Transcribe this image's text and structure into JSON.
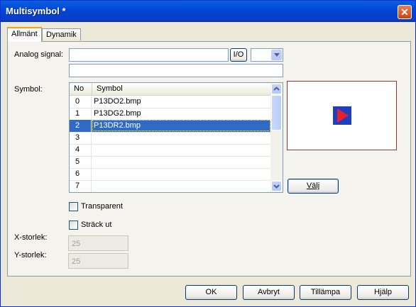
{
  "window": {
    "title": "Multisymbol *",
    "close_glyph": "✕"
  },
  "tabs": [
    {
      "label": "Allmänt"
    },
    {
      "label": "Dynamik"
    }
  ],
  "form": {
    "analog_signal_label": "Analog signal:",
    "analog_signal_value": "",
    "io_button_label": "I/O",
    "combo_value": "",
    "second_field_value": "",
    "symbol_label": "Symbol:",
    "list": {
      "columns": [
        "No",
        "Symbol"
      ],
      "rows": [
        {
          "no": "0",
          "symbol": "P13DO2.bmp"
        },
        {
          "no": "1",
          "symbol": "P13DG2.bmp"
        },
        {
          "no": "2",
          "symbol": "P13DR2.bmp"
        },
        {
          "no": "3",
          "symbol": ""
        },
        {
          "no": "4",
          "symbol": ""
        },
        {
          "no": "5",
          "symbol": ""
        },
        {
          "no": "6",
          "symbol": ""
        },
        {
          "no": "7",
          "symbol": ""
        }
      ],
      "selected_index": 2
    },
    "choose_button_label": "Välj",
    "transparent_label": "Transparent",
    "transparent_checked": false,
    "stretch_label": "Sträck ut",
    "stretch_checked": false,
    "x_size_label": "X-storlek:",
    "x_size_value": "25",
    "y_size_label": "Y-storlek:",
    "y_size_value": "25"
  },
  "footer": {
    "ok": "OK",
    "cancel": "Avbryt",
    "apply": "Tillämpa",
    "help": "Hjälp"
  },
  "colors": {
    "title_bar": "#0054e3",
    "selection": "#316ac5",
    "preview_symbol_bg": "#1e3fc0",
    "preview_symbol_fg": "#e8202a"
  }
}
